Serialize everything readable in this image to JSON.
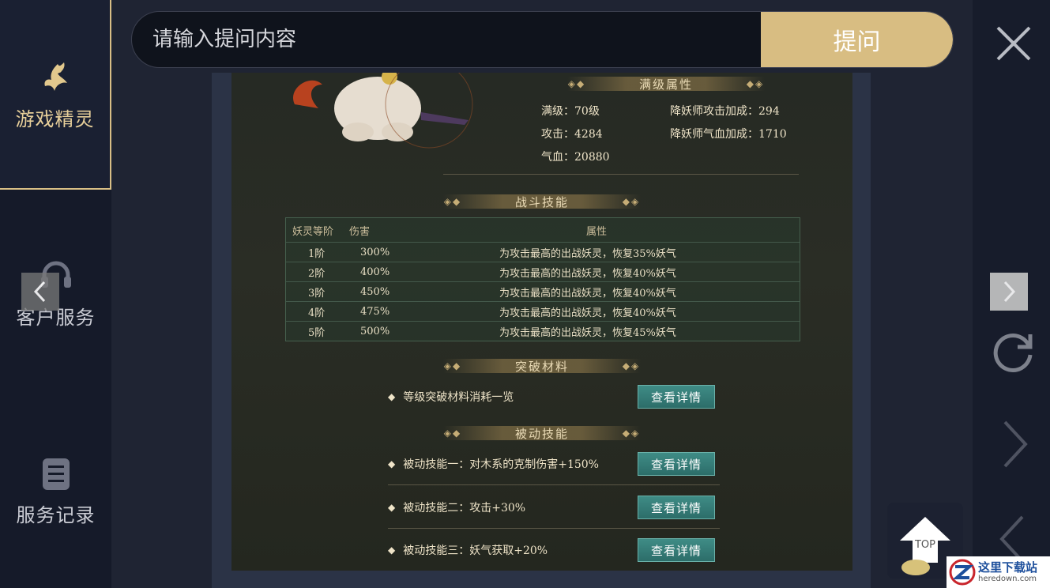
{
  "sidebar": {
    "items": [
      {
        "label": "游戏精灵",
        "icon": "fairy-icon",
        "active": true
      },
      {
        "label": "客户服务",
        "icon": "headset-icon",
        "active": false
      },
      {
        "label": "服务记录",
        "icon": "records-icon",
        "active": false
      }
    ]
  },
  "search": {
    "placeholder": "请输入提问内容",
    "button_label": "提问"
  },
  "content": {
    "max_attr": {
      "title": "满级属性",
      "stats": [
        "满级：70级",
        "降妖师攻击加成：294",
        "攻击：4284",
        "降妖师气血加成：1710",
        "气血：20880"
      ]
    },
    "battle_skill": {
      "title": "战斗技能",
      "headers": [
        "妖灵等阶",
        "伤害",
        "属性"
      ],
      "rows": [
        {
          "level": "1阶",
          "damage": "300%",
          "attr": "为攻击最高的出战妖灵，恢复35%妖气"
        },
        {
          "level": "2阶",
          "damage": "400%",
          "attr": "为攻击最高的出战妖灵，恢复40%妖气"
        },
        {
          "level": "3阶",
          "damage": "450%",
          "attr": "为攻击最高的出战妖灵，恢复40%妖气"
        },
        {
          "level": "4阶",
          "damage": "475%",
          "attr": "为攻击最高的出战妖灵，恢复40%妖气"
        },
        {
          "level": "5阶",
          "damage": "500%",
          "attr": "为攻击最高的出战妖灵，恢复45%妖气"
        }
      ]
    },
    "breakthrough": {
      "title": "突破材料",
      "item": "等级突破材料消耗一览",
      "button": "查看详情"
    },
    "passive": {
      "title": "被动技能",
      "items": [
        {
          "text": "被动技能一：对木系的克制伤害+150%",
          "button": "查看详情"
        },
        {
          "text": "被动技能二：攻击+30%",
          "button": "查看详情"
        },
        {
          "text": "被动技能三：妖气获取+20%",
          "button": "查看详情"
        }
      ]
    }
  },
  "controls": {
    "top_label": "TOP"
  },
  "watermark": {
    "line1": "这里下载站",
    "line2": "heredown.com"
  },
  "colors": {
    "accent_gold": "#d8bd82",
    "detail_button": "#2c6d69",
    "panel_bg": "#262a24"
  }
}
